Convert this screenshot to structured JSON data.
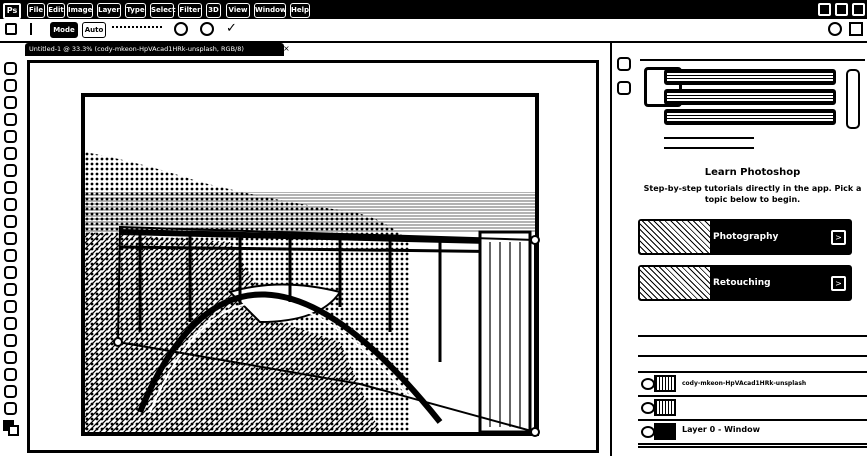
{
  "menubar": {
    "logo": "Ps",
    "items": [
      "File",
      "Edit",
      "Image",
      "Layer",
      "Type",
      "Select",
      "Filter",
      "3D",
      "View",
      "Window",
      "Help"
    ]
  },
  "options": {
    "mode_label": "Mode",
    "auto_label": "Auto"
  },
  "document": {
    "tab_title": "Untitled-1 @ 33.3% (cody-mkeon-HpVAcad1HRk-unsplash, RGB/8)"
  },
  "learn": {
    "title": "Learn Photoshop",
    "subtitle": "Step-by-step tutorials directly in the app. Pick a topic below to begin.",
    "cards": [
      {
        "label": "Photography"
      },
      {
        "label": "Retouching"
      }
    ]
  },
  "layers": {
    "rows": [
      {
        "name": "cody-mkeon-HpVAcad1HRk-unsplash"
      },
      {
        "name": ""
      },
      {
        "name": "Layer 0 - Window"
      }
    ]
  }
}
